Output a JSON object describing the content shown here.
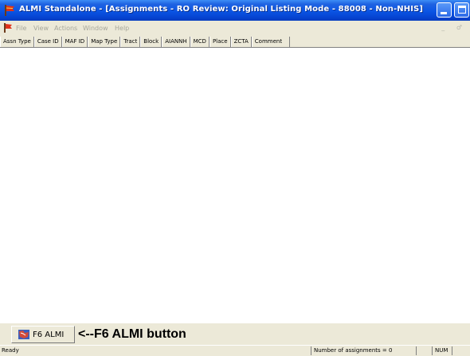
{
  "window": {
    "title": "ALMI Standalone - [Assignments - RO Review: Original Listing Mode - 88008 - Non-NHIS]",
    "app_icon": "almi-flag-icon",
    "accent": "#0a54e4"
  },
  "menubar": {
    "items": [
      "File",
      "View",
      "Actions",
      "Window",
      "Help"
    ]
  },
  "columns": [
    "Assn Type",
    "Case ID",
    "MAF ID",
    "Map Type",
    "Tract",
    "Block",
    "AIANNH",
    "MCD",
    "Place",
    "ZCTA",
    "Comment"
  ],
  "f6": {
    "button_label": "F6 ALMI",
    "icon": "map-icon",
    "annotation": "<--F6 ALMI button"
  },
  "status": {
    "ready": "Ready",
    "assignments": "Number of assignments = 0",
    "num": "NUM"
  }
}
